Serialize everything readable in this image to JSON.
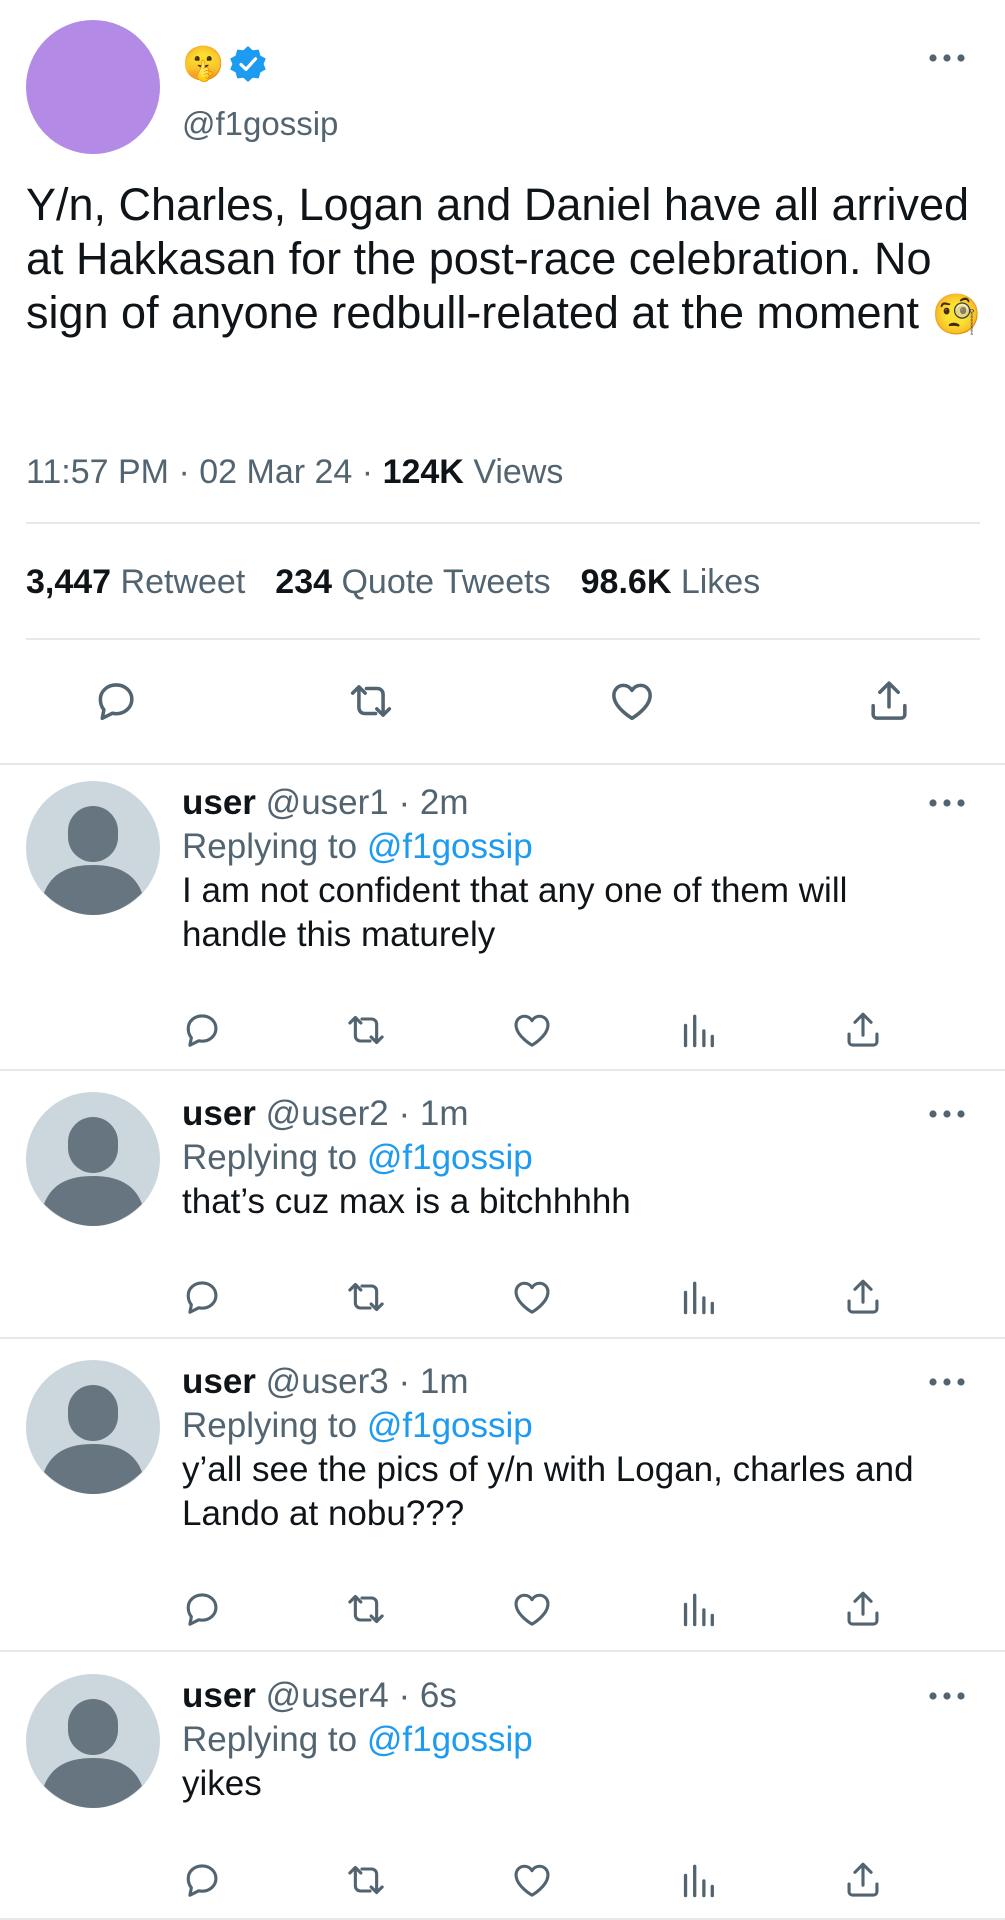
{
  "colors": {
    "avatar_purple": "#b38ae6",
    "verified_blue": "#1d9bf0",
    "mention_blue": "#1d9bf0",
    "secondary_text": "#536471",
    "icon_gray": "#536471",
    "divider": "#e6e9ec",
    "default_avatar_bg": "#ccd6dd",
    "default_avatar_fg": "#66757f"
  },
  "main_tweet": {
    "display_name_emoji": "🤫",
    "verified": true,
    "handle": "@f1gossip",
    "text": "Y/n, Charles, Logan and Daniel have all arrived at Hakkasan for the post-race celebration. No sign of anyone redbull-related at the moment",
    "text_emoji": "🧐",
    "time": "11:57 PM",
    "separator": "·",
    "date": "02 Mar 24",
    "views_count": "124K",
    "views_label": "Views",
    "retweets_count": "3,447",
    "retweets_label": "Retweet",
    "quotes_count": "234",
    "quotes_label": "Quote Tweets",
    "likes_count": "98.6K",
    "likes_label": "Likes",
    "actions": [
      "reply-icon",
      "retweet-icon",
      "like-icon",
      "share-icon"
    ]
  },
  "replies": [
    {
      "name": "user",
      "handle": "@user1",
      "separator": "·",
      "time": "2m",
      "replying_prefix": "Replying to",
      "replying_to": "@f1gossip",
      "text": "I am not confident that any one of them will handle this maturely"
    },
    {
      "name": "user",
      "handle": "@user2",
      "separator": "·",
      "time": "1m",
      "replying_prefix": "Replying to",
      "replying_to": "@f1gossip",
      "text": "that’s cuz max is a bitchhhhh"
    },
    {
      "name": "user",
      "handle": "@user3",
      "separator": "·",
      "time": "1m",
      "replying_prefix": "Replying to",
      "replying_to": "@f1gossip",
      "text": "y’all see the pics of y/n with Logan, charles and Lando at nobu???"
    },
    {
      "name": "user",
      "handle": "@user4",
      "separator": "·",
      "time": "6s",
      "replying_prefix": "Replying to",
      "replying_to": "@f1gossip",
      "text": "yikes"
    }
  ],
  "reply_actions": [
    "reply-icon",
    "retweet-icon",
    "like-icon",
    "views-icon",
    "share-icon"
  ]
}
